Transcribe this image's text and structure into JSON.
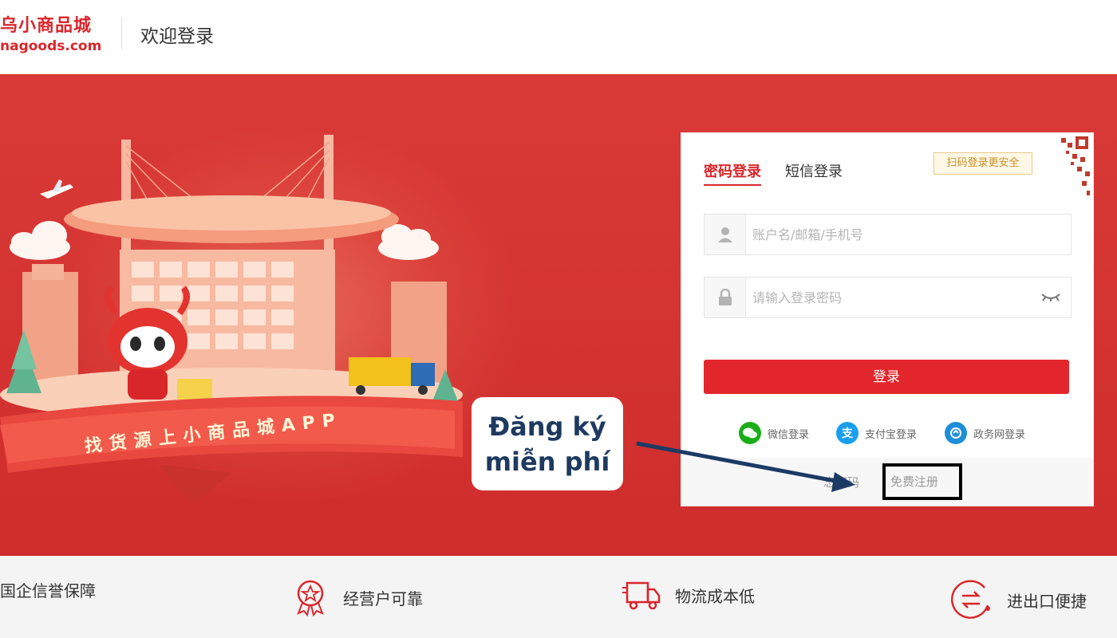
{
  "header": {
    "logo_cn": "乌小商品城",
    "logo_en": "nagoods.com",
    "title": "欢迎登录"
  },
  "hero": {
    "banner_text": "找货源上小商品城APP"
  },
  "login": {
    "tabs": [
      {
        "label": "密码登录",
        "active": true
      },
      {
        "label": "短信登录",
        "active": false
      }
    ],
    "qr_tip": "扫码登录更安全",
    "account_placeholder": "账户名/邮箱/手机号",
    "password_placeholder": "请输入登录密码",
    "submit_label": "登录",
    "social": [
      {
        "label": "微信登录",
        "icon": "wechat-icon",
        "color": "#1aad19"
      },
      {
        "label": "支付宝登录",
        "icon": "alipay-icon",
        "color": "#1a9ff0"
      },
      {
        "label": "政务网登录",
        "icon": "gov-icon",
        "color": "#1e8ed8"
      }
    ],
    "forgot_label": "忘密码",
    "register_label": "免费注册"
  },
  "annotation": {
    "line1": "Đăng ký",
    "line2": "miễn phí"
  },
  "features": [
    {
      "label": "国企信誉保障",
      "icon": "shield-icon"
    },
    {
      "label": "经营户可靠",
      "icon": "award-icon"
    },
    {
      "label": "物流成本低",
      "icon": "truck-icon"
    },
    {
      "label": "进出口便捷",
      "icon": "exchange-icon"
    }
  ],
  "colors": {
    "brand_red": "#d9262b",
    "hero_bg": "#d33533",
    "callout_text": "#1f3a5f"
  }
}
